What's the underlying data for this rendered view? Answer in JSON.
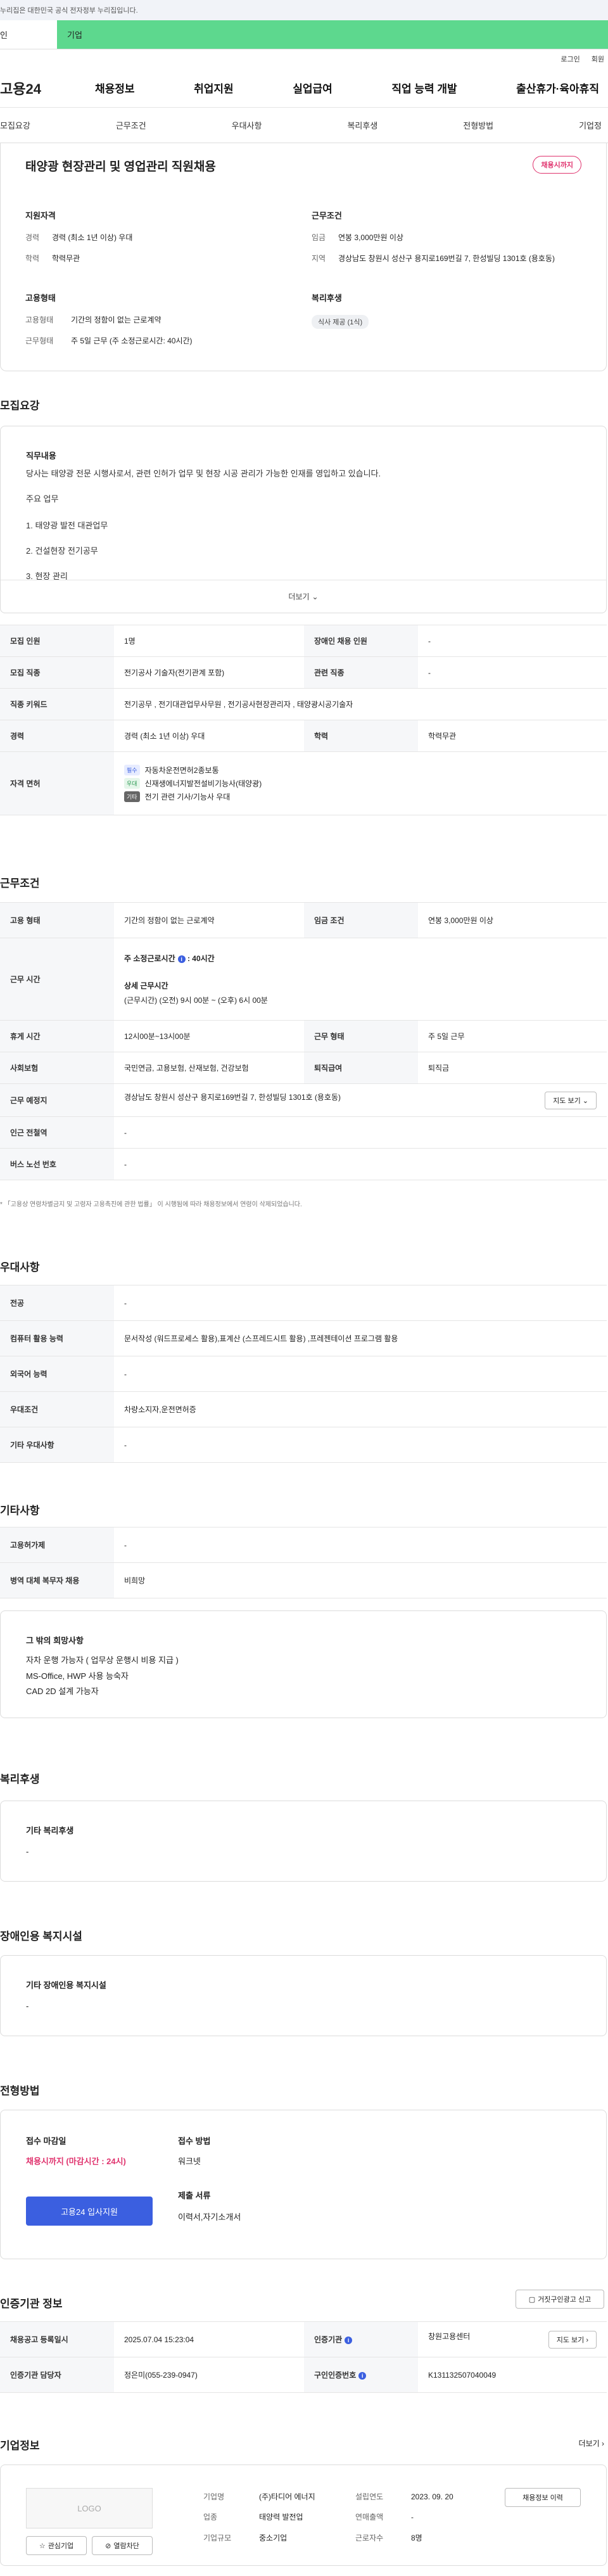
{
  "gov_banner": "누리집은 대한민국 공식 전자정부 누리집입니다.",
  "audience": {
    "person": "인",
    "business": "기업"
  },
  "util": {
    "login": "로그인",
    "signup": "회원"
  },
  "logo": "고용24",
  "gnb": [
    "채용정보",
    "취업지원",
    "실업급여",
    "직업 능력 개발",
    "출산휴가·육아휴직"
  ],
  "subtabs": [
    "모집요강",
    "근무조건",
    "우대사항",
    "복리후생",
    "전형방법",
    "기업정"
  ],
  "summary": {
    "title": "태양광 현장관리 및 영업관리 직원채용",
    "badge": "채용시까지",
    "qual": {
      "heading": "지원자격",
      "rows": [
        {
          "k": "경력",
          "v": "경력 (최소 1년 이상) 우대"
        },
        {
          "k": "학력",
          "v": "학력무관"
        }
      ]
    },
    "cond": {
      "heading": "근무조건",
      "rows": [
        {
          "k": "임금",
          "v": "연봉 3,000만원 이상"
        },
        {
          "k": "지역",
          "v": "경상남도 창원시 성산구 용지로169번길 7, 한성빌딩 1301호 (용호동)"
        }
      ]
    },
    "emp": {
      "heading": "고용형태",
      "rows": [
        {
          "k": "고용형태",
          "v": "기간의 정함이 없는 근로계약"
        },
        {
          "k": "근무형태",
          "v": "주 5일 근무 (주 소정근로시간: 40시간)"
        }
      ]
    },
    "welfare": {
      "heading": "복리후생",
      "chip": "식사 제공 (1식)"
    }
  },
  "recruit": {
    "heading": "모집요강",
    "duty_title": "직무내용",
    "duty_desc": "당사는 태양광 전문 시행사로서, 관련 인허가 업무 및 현장 시공 관리가 가능한 인재를 영입하고 있습니다.",
    "main_task": "주요 업무",
    "tasks": [
      "1. 태양광 발전 대관업무",
      "2. 건설현장 전기공무",
      "3. 현장 관리"
    ],
    "more": "더보기",
    "rows": {
      "count_k": "모집 인원",
      "count_v": "1명",
      "disabled_k": "장애인 채용 인원",
      "disabled_v": "-",
      "job_k": "모집 직종",
      "job_v": "전기공사 기술자(전기관계 포함)",
      "related_k": "관련 직종",
      "related_v": "-",
      "kw_k": "직종 키워드",
      "kw_v": "전기공무 , 전기대관업무사무원 , 전기공사현장관리자 , 태양광시공기술자",
      "career_k": "경력",
      "career_v": "경력 (최소 1년 이상) 우대",
      "edu_k": "학력",
      "edu_v": "학력무관",
      "lic_k": "자격 면허",
      "licenses": [
        {
          "tag": "필수",
          "text": "자동차운전면허2종보통"
        },
        {
          "tag": "우대",
          "text": "신재생에너지발전설비기능사(태양광)"
        },
        {
          "tag": "기타",
          "text": "전기 관련 기사/기능사 우대"
        }
      ]
    }
  },
  "work": {
    "heading": "근무조건",
    "emp_k": "고용 형태",
    "emp_v": "기간의 정함이 없는 근로계약",
    "wage_k": "임금 조건",
    "wage_v": "연봉 3,000만원 이상",
    "hours_k": "근무 시간",
    "hours_week": "주 소정근로시간",
    "hours_week_v": "40시간",
    "hours_detail_t": "상세 근무시간",
    "hours_detail_v": "(근무시간) (오전) 9시 00분 ~ (오후) 6시 00분",
    "break_k": "휴게 시간",
    "break_v": "12시00분~13시00분",
    "form_k": "근무 형태",
    "form_v": "주 5일 근무",
    "ins_k": "사회보험",
    "ins_v": "국민연금, 고용보험, 산재보험, 건강보험",
    "sev_k": "퇴직급여",
    "sev_v": "퇴직금",
    "place_k": "근무 예정지",
    "place_v": "경상남도 창원시 성산구 용지로169번길 7, 한성빌딩 1301호 (용호동)",
    "map_btn": "지도 보기",
    "subway_k": "인근 전철역",
    "subway_v": "-",
    "bus_k": "버스 노선 번호",
    "bus_v": "-",
    "note": "* 「고용상 연령차별금지 및 고령자 고용촉진에 관한 법률」 이 시행됨에 따라 채용정보에서 연령이 삭제되었습니다."
  },
  "pref": {
    "heading": "우대사항",
    "rows": [
      {
        "k": "전공",
        "v": "-"
      },
      {
        "k": "컴퓨터 활용 능력",
        "v": "문서작성 (워드프로세스 활용),표계산 (스프레드시트 활용) ,프레젠테이션 프로그램 활용"
      },
      {
        "k": "외국어 능력",
        "v": "-"
      },
      {
        "k": "우대조건",
        "v": "차량소지자,운전면허증"
      },
      {
        "k": "기타 우대사항",
        "v": "-"
      }
    ]
  },
  "etc": {
    "heading": "기타사항",
    "rows": [
      {
        "k": "고용허가제",
        "v": "-"
      },
      {
        "k": "병역 대체 복무자 채용",
        "v": "비희망"
      }
    ],
    "wish_title": "그 밖의 희망사항",
    "wish_lines": [
      "자차 운행 가능자 ( 업무상 운행시 비용 지급 )",
      "MS-Office, HWP 사용 능숙자",
      "CAD 2D 설계 가능자"
    ]
  },
  "benefit": {
    "heading": "복리후생",
    "sub": "기타 복리후생",
    "value": "-"
  },
  "disab": {
    "heading": "장애인용 복지시설",
    "sub": "기타 장애인용 복지시설",
    "value": "-"
  },
  "select": {
    "heading": "전형방법",
    "deadline_t": "접수 마감일",
    "deadline_v": "채용시까지 (마감시간 : 24시)",
    "apply_btn": "고용24 입사지원",
    "method_t": "접수 방법",
    "method_v": "워크넷",
    "docs_t": "제출 서류",
    "docs_v": "이력서,자기소개서"
  },
  "cert": {
    "heading": "인증기관 정보",
    "report_btn": "거짓구인광고 신고",
    "reg_k": "채용공고 등록일시",
    "reg_v": "2025.07.04 15:23:04",
    "org_k": "인증기관",
    "org_v": "창원고용센터",
    "map_btn": "지도 보기",
    "mgr_k": "인증기관 담당자",
    "mgr_v": "정은미(055-239-0947)",
    "no_k": "구인인증번호",
    "no_v": "K131132507040049"
  },
  "company": {
    "heading": "기업정보",
    "more": "더보기",
    "logo": "LOGO",
    "fav_btn": "관심기업",
    "block_btn": "열람차단",
    "name_k": "기업명",
    "name_v": "(주)타디어 에너지",
    "est_k": "설립연도",
    "est_v": "2023. 09. 20",
    "ind_k": "업종",
    "ind_v": "태양력 발전업",
    "sales_k": "연매출액",
    "sales_v": "-",
    "size_k": "기업규모",
    "size_v": "중소기업",
    "emp_k": "근로자수",
    "emp_v": "8명",
    "history_btn": "채용정보 이력"
  }
}
